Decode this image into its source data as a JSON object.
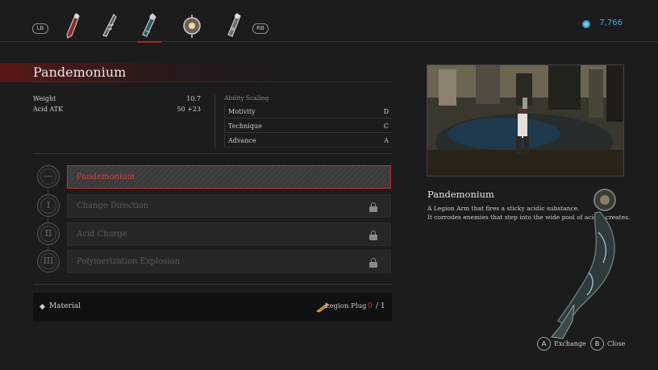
{
  "topbar": {
    "left_bumper": "LB",
    "right_bumper": "RB",
    "weapons": [
      "weapon-1",
      "weapon-2",
      "weapon-3",
      "weapon-4",
      "weapon-5"
    ],
    "active_index": 2,
    "ergo_amount": "7,766",
    "ergo_icon": "ergo-orb-icon"
  },
  "header": {
    "title": "Pandemonium"
  },
  "stats": [
    {
      "label": "Weight",
      "value": "10.7"
    },
    {
      "label": "Acid ATK",
      "value": "50 +23"
    }
  ],
  "scaling": {
    "heading": "Ability Scaling",
    "rows": [
      {
        "label": "Motivity",
        "grade": "D"
      },
      {
        "label": "Technique",
        "grade": "C"
      },
      {
        "label": "Advance",
        "grade": "A"
      }
    ]
  },
  "skills": [
    {
      "node": "—",
      "label": "Pandemonium",
      "locked": false,
      "selected": true
    },
    {
      "node": "I",
      "label": "Change Direction",
      "locked": true,
      "selected": false
    },
    {
      "node": "II",
      "label": "Acid Charge",
      "locked": true,
      "selected": false
    },
    {
      "node": "III",
      "label": "Polymerization Explosion",
      "locked": true,
      "selected": false
    }
  ],
  "material": {
    "label": "Material",
    "item": "Legion Plug",
    "have": "0",
    "need": "/ 1"
  },
  "detail": {
    "title": "Pandemonium",
    "desc1": "A Legion Arm that fires a sticky acidic substance.",
    "desc2": "It corrodes enemies that step into the wide pool of acid it creates."
  },
  "hints": [
    {
      "button": "A",
      "label": "Exchange"
    },
    {
      "button": "B",
      "label": "Close"
    }
  ],
  "colors": {
    "accent": "#c0302a",
    "ergo": "#4fa9d6"
  }
}
